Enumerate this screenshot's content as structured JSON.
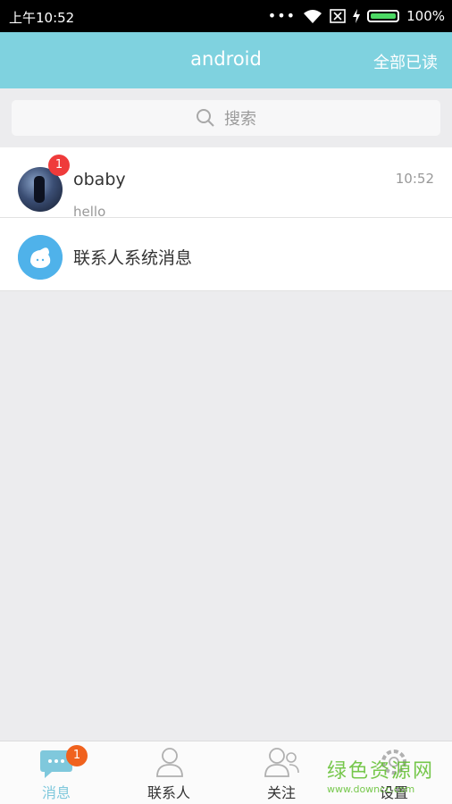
{
  "status_bar": {
    "time": "上午10:52",
    "signal_dots": "•••",
    "battery_pct": "100%",
    "icons": [
      "wifi-icon",
      "sim-off-icon",
      "charging-icon",
      "battery-icon"
    ]
  },
  "header": {
    "title": "android",
    "action_label": "全部已读",
    "color": "#7fd2df"
  },
  "search": {
    "placeholder": "搜索",
    "icon": "search-icon"
  },
  "conversations": [
    {
      "name": "obaby",
      "preview": "hello",
      "time": "10:52",
      "unread": "1",
      "avatar": "user-avatar"
    },
    {
      "name": "联系人系统消息",
      "avatar": "system-message-avatar"
    }
  ],
  "tabs": [
    {
      "label": "消息",
      "icon": "chat-bubble-icon",
      "badge": "1",
      "active": true
    },
    {
      "label": "联系人",
      "icon": "person-icon"
    },
    {
      "label": "关注",
      "icon": "people-icon"
    },
    {
      "label": "设置",
      "icon": "gear-icon"
    }
  ],
  "watermark": {
    "text": "绿色资源网",
    "url": "www.downcc.com"
  },
  "colors": {
    "accent": "#7fd2df",
    "badge": "#ef3b3b",
    "tab_badge": "#f0621e",
    "system_avatar": "#4fb2ea"
  }
}
